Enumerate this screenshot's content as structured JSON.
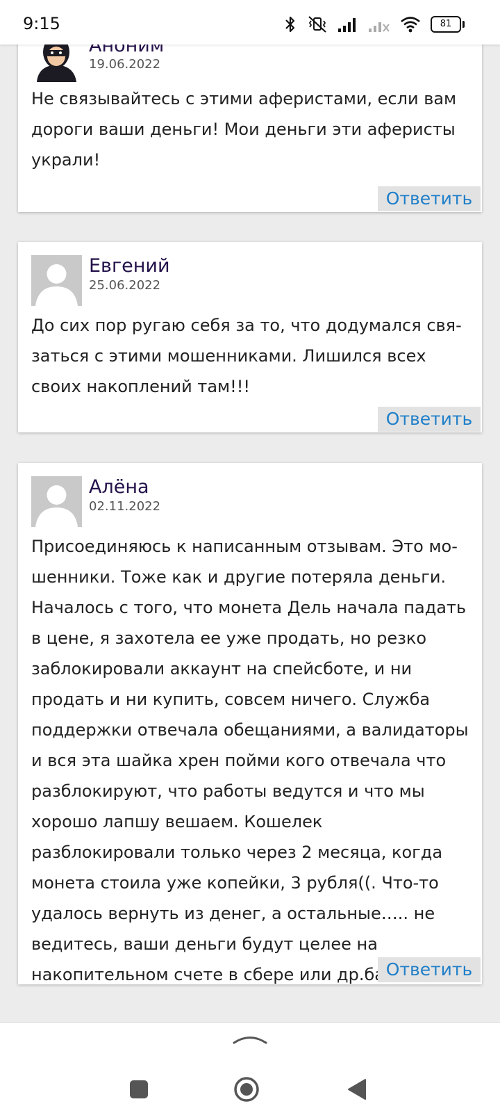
{
  "status_bar": {
    "time": "9:15",
    "battery": "81",
    "icons": [
      "bluetooth-icon",
      "silent-vibrate-icon",
      "signal-icon",
      "signal-no-service-icon",
      "wifi-icon",
      "battery-icon"
    ]
  },
  "comments": [
    {
      "author": "Аноним",
      "date": "19.06.2022",
      "avatar": "masked-user-avatar",
      "text": "Не связывайтесь с этими аферистами, если вам дороги ваши деньги! Мои деньги эти аферисты украли!",
      "reply_label": "Ответить"
    },
    {
      "author": "Евгений",
      "date": "25.06.2022",
      "avatar": "default-user-avatar",
      "text": "До сих пор ругаю себя за то, что додумался свя­заться с этими мошенниками. Лишился всех своих накоплений там!!!",
      "reply_label": "Ответить"
    },
    {
      "author": "Алёна",
      "date": "02.11.2022",
      "avatar": "default-user-avatar",
      "text": "Присоединяюсь к написанным отзывам. Это мо­шенники. Тоже как и другие потеряла деньги. Нача­лось с того, что монета Дель начала падать в цене, я захотела ее уже продать, но резко заблокировали аккаунт на спейсботе, и ни продать и ни купить, со­всем ничего. Служба поддержки отвечала обеща­ниями, а валидаторы и вся эта шайка хрен пойми кого отвечала что разблокируют, что работы ве­дутся и что мы хорошо лапшу вешаем. Кошелек разблокировали только через 2 месяца, когда мо­нета стоила уже копейки, 3 рубля((. Что-то удалось вернуть из денег, а остальные….. не ведитесь, ваши деньги будут целее на накопительном счете в сбере или др.банках.",
      "reply_label": "Ответить"
    }
  ],
  "nav": {
    "icons": [
      "chevron-up-icon",
      "recents-square-icon",
      "home-circle-icon",
      "back-triangle-icon"
    ]
  }
}
